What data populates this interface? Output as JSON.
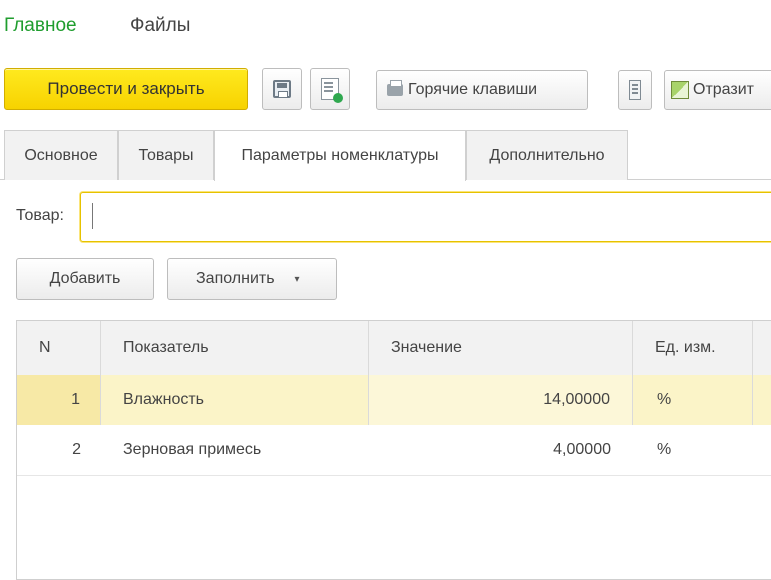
{
  "nav": {
    "main": "Главное",
    "files": "Файлы"
  },
  "toolbar": {
    "post_close": "Провести и закрыть",
    "save_icon": "floppy-icon",
    "doc_icon": "document-status-icon",
    "hotkeys": "Горячие клавиши",
    "list_icon": "list-icon",
    "reflect": "Отразит"
  },
  "tabs": [
    "Основное",
    "Товары",
    "Параметры номенклатуры",
    "Дополнительно"
  ],
  "active_tab": "Параметры номенклатуры",
  "product_field": {
    "label": "Товар:",
    "value": ""
  },
  "actions": {
    "add": "Добавить",
    "fill": "Заполнить"
  },
  "table": {
    "columns": [
      "N",
      "Показатель",
      "Значение",
      "Ед. изм."
    ],
    "rows": [
      {
        "n": "1",
        "indicator": "Влажность",
        "value": "14,00000",
        "unit": "%"
      },
      {
        "n": "2",
        "indicator": "Зерновая примесь",
        "value": "4,00000",
        "unit": "%"
      }
    ]
  },
  "colors": {
    "accent_green": "#1f9d2e",
    "primary_button": "#f7d200",
    "selected_row": "#fbf4c8"
  }
}
